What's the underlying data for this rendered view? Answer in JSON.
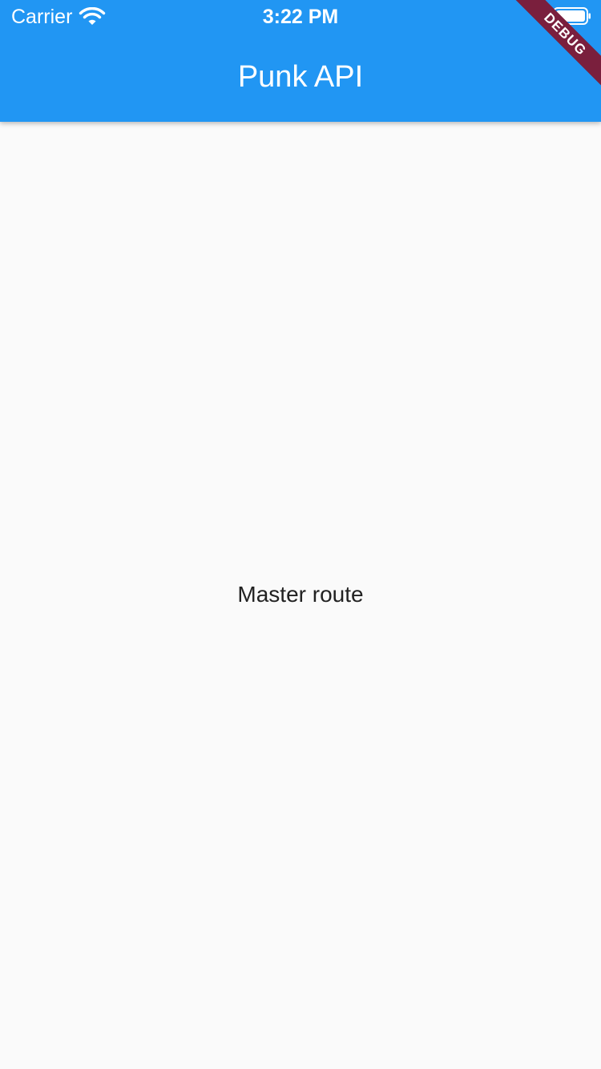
{
  "status_bar": {
    "carrier": "Carrier",
    "time": "3:22 PM",
    "wifi_icon": "wifi-icon",
    "battery_icon": "battery-icon"
  },
  "app_bar": {
    "title": "Punk API",
    "color": "#2196f3"
  },
  "body": {
    "text": "Master route"
  },
  "debug_banner": {
    "label": "DEBUG",
    "color": "#7a1f3d"
  }
}
